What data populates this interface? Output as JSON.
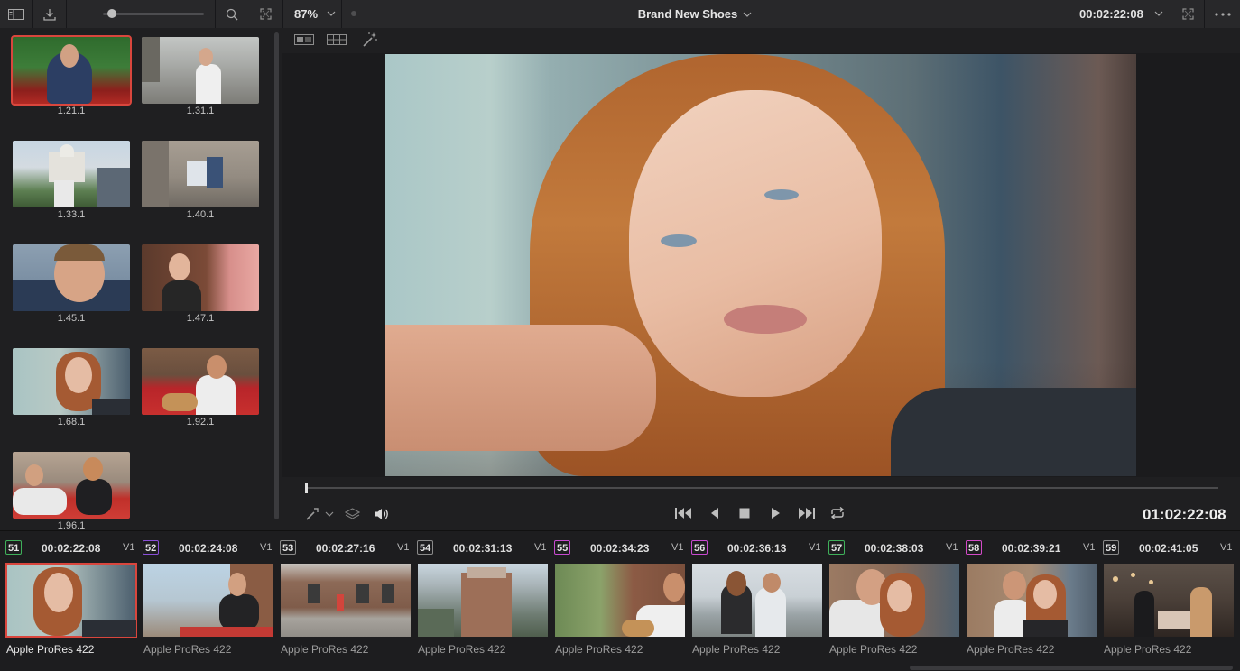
{
  "toolbar": {
    "zoom": "87%",
    "title": "Brand New Shoes",
    "timecode": "00:02:22:08",
    "zoom_slider_value": 0.05
  },
  "gallery": {
    "stills": [
      {
        "label": "1.21.1",
        "selected": true
      },
      {
        "label": "1.31.1"
      },
      {
        "label": "1.33.1"
      },
      {
        "label": "1.40.1"
      },
      {
        "label": "1.45.1"
      },
      {
        "label": "1.47.1"
      },
      {
        "label": "1.68.1"
      },
      {
        "label": "1.92.1"
      },
      {
        "label": "1.96.1"
      }
    ]
  },
  "viewer": {
    "timecode": "01:02:22:08",
    "playhead_position": 0.0
  },
  "timeline": {
    "clips": [
      {
        "num": "51",
        "tc": "00:02:22:08",
        "track": "V1",
        "codec": "Apple ProRes 422",
        "color": "#3fb05a",
        "selected": true
      },
      {
        "num": "52",
        "tc": "00:02:24:08",
        "track": "V1",
        "codec": "Apple ProRes 422",
        "color": "#8a4fd8"
      },
      {
        "num": "53",
        "tc": "00:02:27:16",
        "track": "V1",
        "codec": "Apple ProRes 422",
        "color": "#8a8a8a"
      },
      {
        "num": "54",
        "tc": "00:02:31:13",
        "track": "V1",
        "codec": "Apple ProRes 422",
        "color": "#8a8a8a"
      },
      {
        "num": "55",
        "tc": "00:02:34:23",
        "track": "V1",
        "codec": "Apple ProRes 422",
        "color": "#c84ad0"
      },
      {
        "num": "56",
        "tc": "00:02:36:13",
        "track": "V1",
        "codec": "Apple ProRes 422",
        "color": "#c84ad0"
      },
      {
        "num": "57",
        "tc": "00:02:38:03",
        "track": "V1",
        "codec": "Apple ProRes 422",
        "color": "#3fb05a"
      },
      {
        "num": "58",
        "tc": "00:02:39:21",
        "track": "V1",
        "codec": "Apple ProRes 422",
        "color": "#d44ac8"
      },
      {
        "num": "59",
        "tc": "00:02:41:05",
        "track": "V1",
        "codec": "Apple ProRes 422",
        "color": "#8a8a8a"
      }
    ]
  },
  "colors": {
    "selection": "#d9463d",
    "panel": "#1f1f21",
    "toolbar": "#28282a"
  },
  "icons": [
    "sidebar-toggle-icon",
    "import-icon",
    "search-icon",
    "fullscreen-icon",
    "dropdown-arrow-icon",
    "fullscreen-icon",
    "more-icon",
    "split-view-icon",
    "grid-view-icon",
    "magic-wand-icon",
    "pointer-icon",
    "layers-icon",
    "volume-icon",
    "skip-back-icon",
    "step-back-icon",
    "stop-icon",
    "play-icon",
    "skip-forward-icon",
    "loop-icon"
  ]
}
